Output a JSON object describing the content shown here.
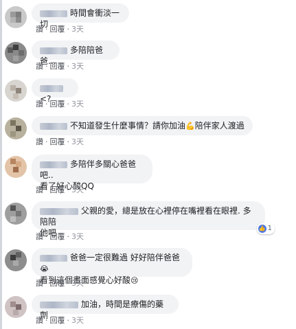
{
  "labels": {
    "reply": "讚",
    "comment": "回覆",
    "time": "3天",
    "dot": "·"
  },
  "comments": [
    {
      "text": "時間會衝淡一切"
    },
    {
      "text": "多陪陪爸爸..."
    },
    {
      "text": "<?"
    },
    {
      "text_before": "不知道發生什麼事情？請你加油",
      "emoji": "💪",
      "text_after": "陪伴家人渡過"
    },
    {
      "line1": "多陪伴多關心爸爸吧..",
      "line2": "看了好心酸QQ"
    },
    {
      "line1": "父親的愛，總是放在心裡停在嘴裡看在眼裡. 多陪陪",
      "line2": "他吧",
      "reaction_count": "1"
    },
    {
      "line1_text": "爸爸一定很難過 好好陪伴爸爸",
      "line1_emoji": "😭",
      "line2_text": "看到這個畫面感覺心好酸",
      "line2_emoji": "😢"
    },
    {
      "text": "加油，時間是療傷的藥劑"
    }
  ],
  "colors": {
    "bubble": "#f2f3f5",
    "link": "#4b4f56",
    "time": "#90949c",
    "like": "#4a76e8"
  }
}
